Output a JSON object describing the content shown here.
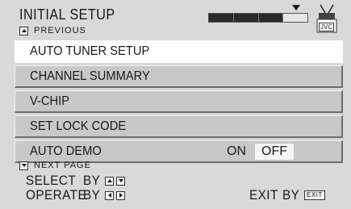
{
  "header": {
    "title": "INITIAL SETUP",
    "previous_label": "PREVIOUS",
    "progress_filled_fraction": 0.75,
    "brand_icon_label": "JVC"
  },
  "menu": {
    "items": [
      {
        "label": "AUTO TUNER SETUP",
        "selected": true
      },
      {
        "label": "CHANNEL SUMMARY",
        "selected": false
      },
      {
        "label": "V-CHIP",
        "selected": false
      },
      {
        "label": "SET LOCK CODE",
        "selected": false
      },
      {
        "label": "AUTO DEMO",
        "selected": false,
        "option_on": "ON",
        "option_off": "OFF",
        "current_value": "OFF"
      }
    ]
  },
  "footer": {
    "next_label": "NEXT PAGE",
    "select_label": "SELECT",
    "select_by": "BY",
    "operate_label": "OPERATE",
    "operate_by": "BY",
    "exit_label": "EXIT",
    "exit_by": "BY",
    "exit_button_label": "EXIT"
  },
  "colors": {
    "background": "#d9d9d9",
    "menu_item": "#c8c8c8",
    "selected_item": "#ffffff",
    "text": "#1a1a1a"
  }
}
